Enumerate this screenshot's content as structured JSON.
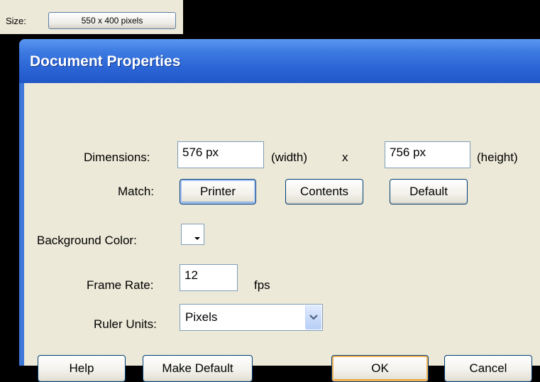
{
  "toolbar": {
    "size_label": "Size:",
    "size_button": "550 x 400 pixels"
  },
  "dialog": {
    "title": "Document Properties",
    "dimensions": {
      "label": "Dimensions:",
      "width_value": "576 px",
      "width_unit": "(width)",
      "separator": "x",
      "height_value": "756 px",
      "height_unit": "(height)"
    },
    "match": {
      "label": "Match:",
      "printer": "Printer",
      "contents": "Contents",
      "default": "Default"
    },
    "background": {
      "label": "Background Color:",
      "color": "#FFFFFF"
    },
    "frame_rate": {
      "label": "Frame Rate:",
      "value": "12",
      "unit": "fps"
    },
    "ruler": {
      "label": "Ruler Units:",
      "selected": "Pixels"
    },
    "buttons": {
      "help": "Help",
      "make_default": "Make Default",
      "ok": "OK",
      "cancel": "Cancel"
    }
  }
}
